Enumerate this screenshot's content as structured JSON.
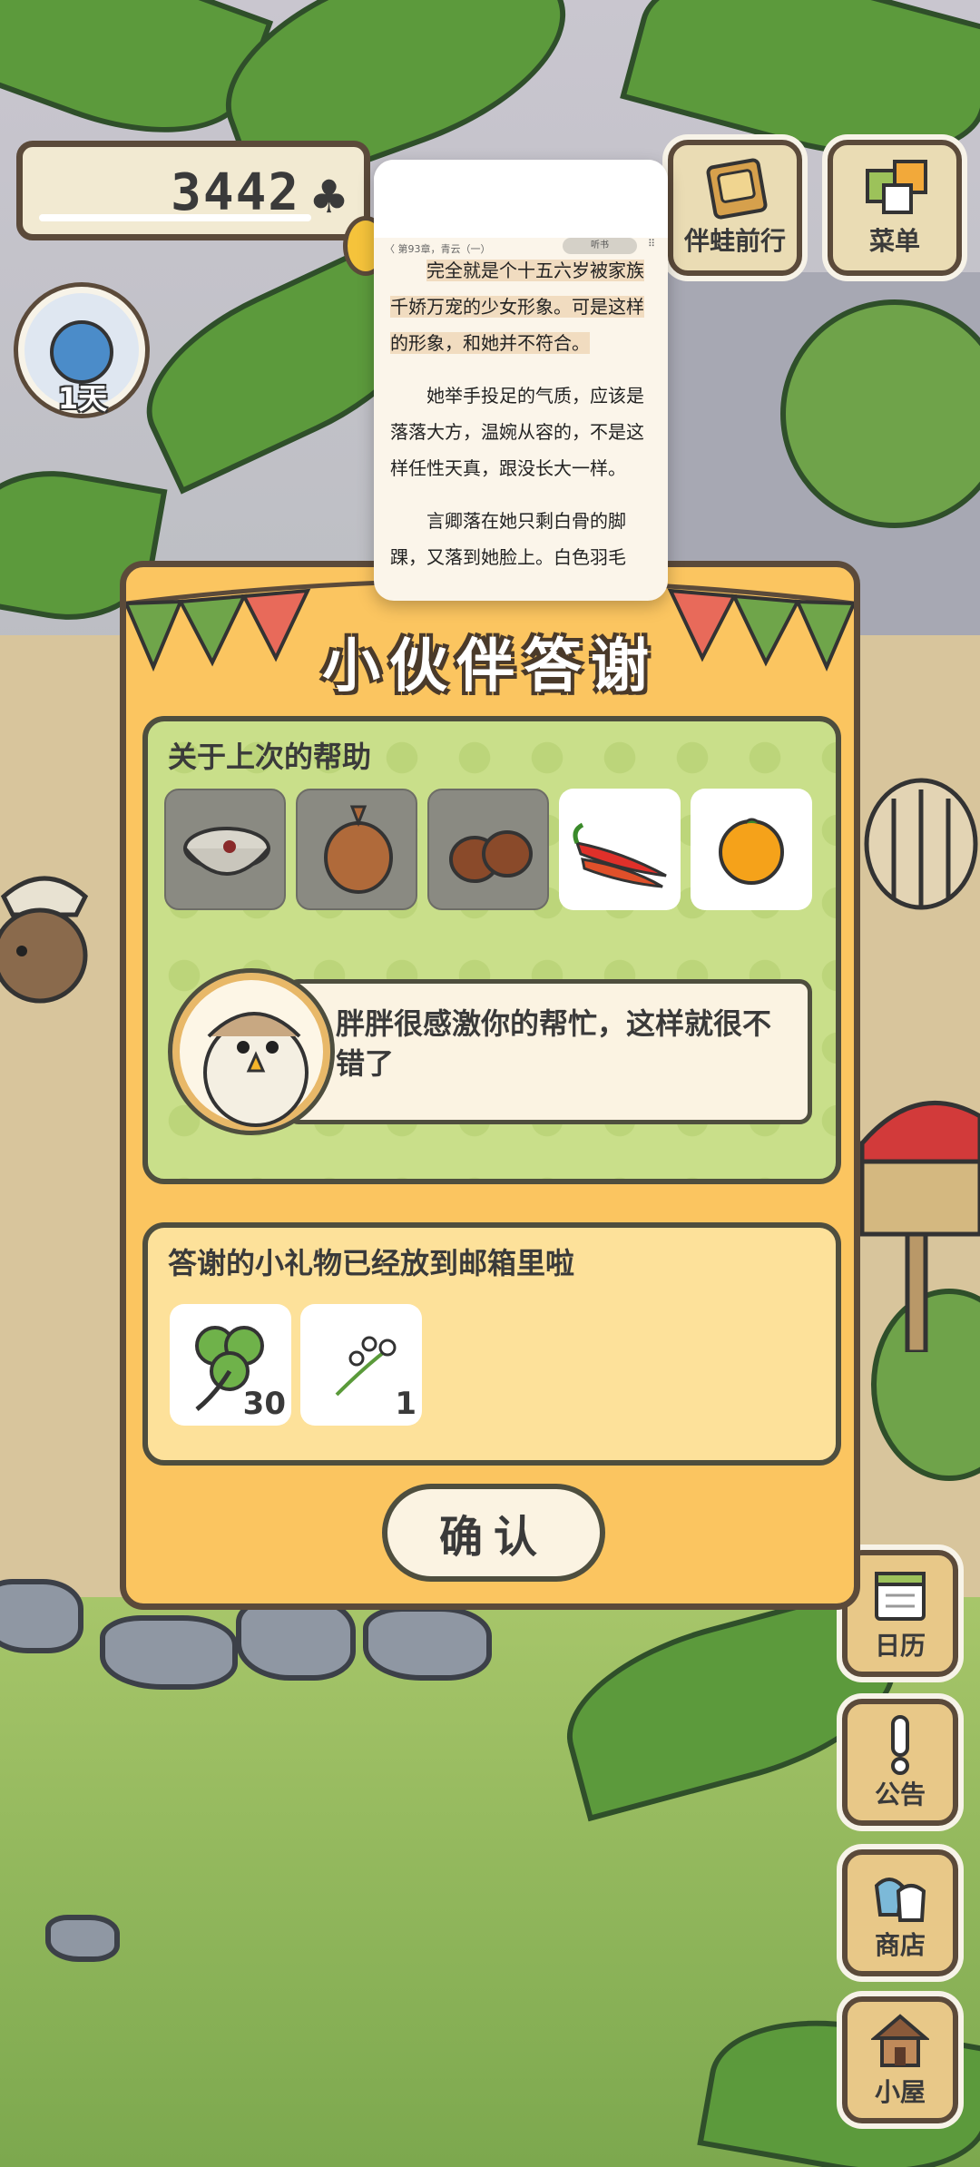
{
  "hud": {
    "clover_count": "3442",
    "days_label": "1天"
  },
  "top_menu": [
    {
      "label": "伴蛙前行",
      "icon": "album-icon"
    },
    {
      "label": "菜单",
      "icon": "menu-cards-icon"
    }
  ],
  "side_menu": [
    {
      "label": "日历",
      "icon": "calendar-icon"
    },
    {
      "label": "公告",
      "icon": "exclamation-icon"
    },
    {
      "label": "商店",
      "icon": "shop-bags-icon"
    },
    {
      "label": "小屋",
      "icon": "house-icon"
    }
  ],
  "dialog": {
    "title": "小伙伴答谢",
    "help_section": {
      "title": "关于上次的帮助",
      "items": [
        {
          "name": "bowl",
          "state": "used"
        },
        {
          "name": "onion",
          "state": "used"
        },
        {
          "name": "chestnuts",
          "state": "used"
        },
        {
          "name": "chili-peppers",
          "state": "fresh"
        },
        {
          "name": "orange",
          "state": "fresh"
        }
      ],
      "speech": "胖胖很感激你的帮忙，这样就很不错了"
    },
    "gift_section": {
      "title": "答谢的小礼物已经放到邮箱里啦",
      "gifts": [
        {
          "name": "clover",
          "count": "30"
        },
        {
          "name": "flower-bud",
          "count": "1"
        }
      ]
    },
    "confirm_label": "确认"
  },
  "reader": {
    "crumb": "〈 第93章，青云（一）",
    "pill": "听书",
    "paragraphs": [
      "完全就是个十五六岁被家族千娇万宠的少女形象。可是这样的形象，和她并不符合。",
      "她举手投足的气质，应该是落落大方，温婉从容的，不是这样任性天真，跟没长大一样。",
      "言卿落在她只剩白骨的脚踝，又落到她脸上。白色羽毛"
    ]
  },
  "colors": {
    "dialog_bg": "#fbc560",
    "help_panel_bg": "#c9df8a",
    "gift_panel_bg": "#fde19a",
    "outline": "#5b4a3a"
  }
}
